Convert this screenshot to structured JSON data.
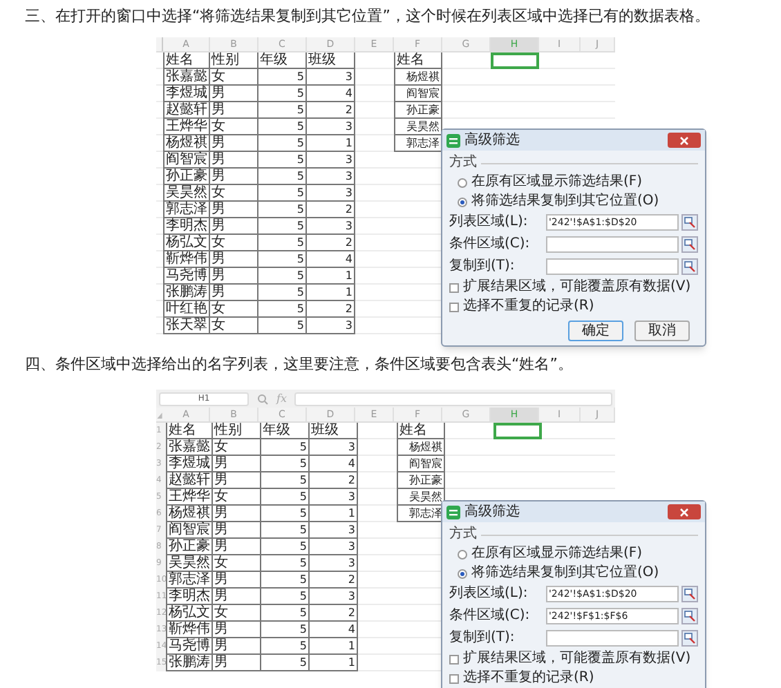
{
  "steps": [
    {
      "text": "三、在打开的窗口中选择“将筛选结果复制到其它位置”，这个时候在列表区域中选择已有的数据表格。",
      "sheet": {
        "columns": [
          {
            "label": "A",
            "selected": false
          },
          {
            "label": "B",
            "selected": false
          },
          {
            "label": "C",
            "selected": false
          },
          {
            "label": "D",
            "selected": false
          },
          {
            "label": "E",
            "selected": false
          },
          {
            "label": "F",
            "selected": false
          },
          {
            "label": "G",
            "selected": false
          },
          {
            "label": "H",
            "selected": true
          },
          {
            "label": "I",
            "selected": false
          },
          {
            "label": "J",
            "selected": false
          }
        ],
        "header": [
          "姓名",
          "性别",
          "年级",
          "班级"
        ],
        "rows": [
          [
            "张嘉懿",
            "女",
            "5",
            "3"
          ],
          [
            "李煜城",
            "男",
            "5",
            "4"
          ],
          [
            "赵懿轩",
            "男",
            "5",
            "2"
          ],
          [
            "王烨华",
            "女",
            "5",
            "3"
          ],
          [
            "杨煜祺",
            "男",
            "5",
            "1"
          ],
          [
            "阎智宸",
            "男",
            "5",
            "3"
          ],
          [
            "孙正豪",
            "男",
            "5",
            "3"
          ],
          [
            "吴昊然",
            "女",
            "5",
            "3"
          ],
          [
            "郭志泽",
            "男",
            "5",
            "2"
          ],
          [
            "李明杰",
            "男",
            "5",
            "3"
          ],
          [
            "杨弘文",
            "女",
            "5",
            "2"
          ],
          [
            "靳烨伟",
            "男",
            "5",
            "4"
          ],
          [
            "马尧博",
            "男",
            "5",
            "1"
          ],
          [
            "张鹏涛",
            "男",
            "5",
            "1"
          ],
          [
            "叶红艳",
            "女",
            "5",
            "2"
          ],
          [
            "张天翠",
            "女",
            "5",
            "3"
          ]
        ],
        "criteria": [
          "姓名",
          "杨煜祺",
          "阎智宸",
          "孙正豪",
          "吴昊然",
          "郭志泽"
        ],
        "dialog": {
          "title": "高级筛选",
          "section": "方式",
          "options": [
            {
              "label": "在原有区域显示筛选结果(F)",
              "selected": false
            },
            {
              "label": "将筛选结果复制到其它位置(O)",
              "selected": true
            }
          ],
          "fields": [
            {
              "label": "列表区域(L):",
              "value": "'242'!$A$1:$D$20"
            },
            {
              "label": "条件区域(C):"
            },
            {
              "label": "复制到(T):"
            }
          ],
          "checkboxes": [
            {
              "label": "扩展结果区域，可能覆盖原有数据(V)",
              "checked": false
            },
            {
              "label": "选择不重复的记录(R)",
              "checked": false
            }
          ],
          "buttons": [
            "确定",
            "取消"
          ]
        }
      }
    },
    {
      "text": "四、条件区域中选择给出的名字列表，这里要注意，条件区域要包含表头“姓名”。",
      "sheet": {
        "formula_bar": {
          "name_box": "H1",
          "function_label": "fx"
        },
        "columns": [
          {
            "label": "A",
            "selected": false
          },
          {
            "label": "B",
            "selected": false
          },
          {
            "label": "C",
            "selected": false
          },
          {
            "label": "D",
            "selected": false
          },
          {
            "label": "E",
            "selected": false
          },
          {
            "label": "F",
            "selected": false
          },
          {
            "label": "G",
            "selected": false
          },
          {
            "label": "H",
            "selected": true
          },
          {
            "label": "I",
            "selected": false
          },
          {
            "label": "J",
            "selected": false
          }
        ],
        "row_numbers": [
          "1",
          "2",
          "3",
          "4",
          "5",
          "6",
          "7",
          "8",
          "9",
          "10",
          "11",
          "12",
          "13",
          "14",
          "15"
        ],
        "header": [
          "姓名",
          "性别",
          "年级",
          "班级"
        ],
        "rows": [
          [
            "张嘉懿",
            "女",
            "5",
            "3"
          ],
          [
            "李煜城",
            "男",
            "5",
            "4"
          ],
          [
            "赵懿轩",
            "男",
            "5",
            "2"
          ],
          [
            "王烨华",
            "女",
            "5",
            "3"
          ],
          [
            "杨煜祺",
            "男",
            "5",
            "1"
          ],
          [
            "阎智宸",
            "男",
            "5",
            "3"
          ],
          [
            "孙正豪",
            "男",
            "5",
            "3"
          ],
          [
            "吴昊然",
            "女",
            "5",
            "3"
          ],
          [
            "郭志泽",
            "男",
            "5",
            "2"
          ],
          [
            "李明杰",
            "男",
            "5",
            "3"
          ],
          [
            "杨弘文",
            "女",
            "5",
            "2"
          ],
          [
            "靳烨伟",
            "男",
            "5",
            "4"
          ],
          [
            "马尧博",
            "男",
            "5",
            "1"
          ],
          [
            "张鹏涛",
            "男",
            "5",
            "1"
          ]
        ],
        "criteria": [
          "姓名",
          "杨煜祺",
          "阎智宸",
          "孙正豪",
          "吴昊然",
          "郭志泽"
        ],
        "dialog": {
          "title": "高级筛选",
          "section": "方式",
          "options": [
            {
              "label": "在原有区域显示筛选结果(F)",
              "selected": false
            },
            {
              "label": "将筛选结果复制到其它位置(O)",
              "selected": true
            }
          ],
          "fields": [
            {
              "label": "列表区域(L):",
              "value": "'242'!$A$1:$D$20"
            },
            {
              "label": "条件区域(C):",
              "value": "'242'!$F$1:$F$6"
            },
            {
              "label": "复制到(T):"
            }
          ],
          "checkboxes": [
            {
              "label": "扩展结果区域，可能覆盖原有数据(V)",
              "checked": false
            },
            {
              "label": "选择不重复的记录(R)",
              "checked": false
            }
          ]
        }
      }
    }
  ]
}
